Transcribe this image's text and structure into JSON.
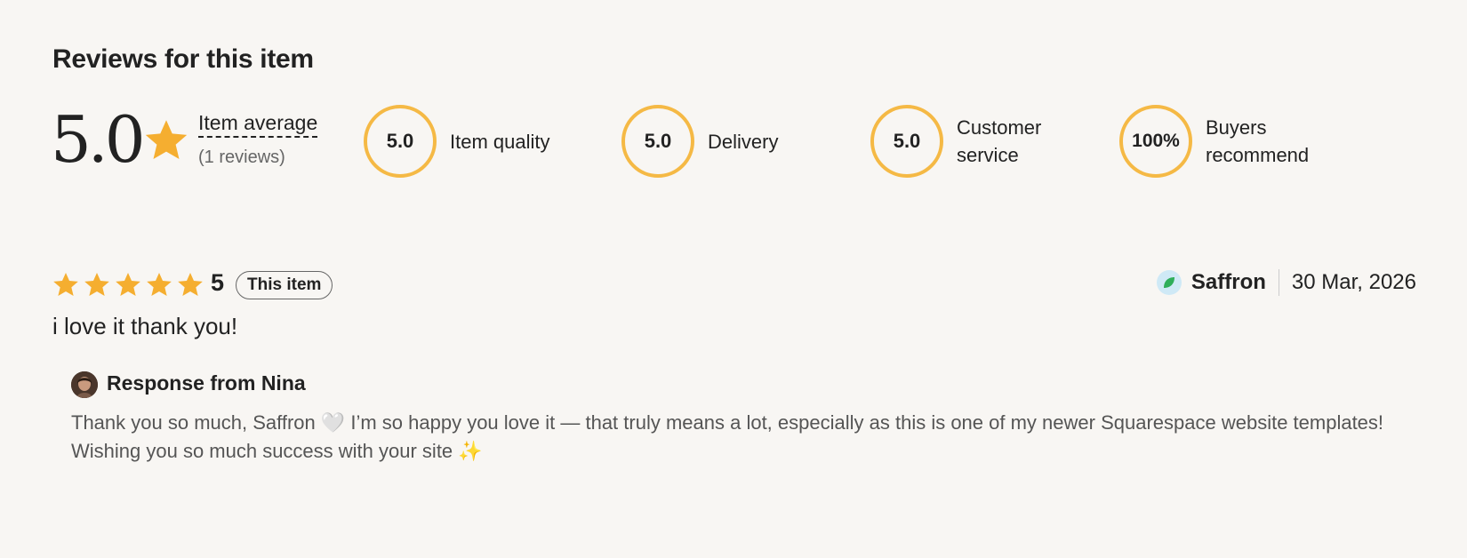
{
  "title": "Reviews for this item",
  "summary": {
    "average": "5.0",
    "average_label": "Item average",
    "review_count": "(1 reviews)",
    "metrics": [
      {
        "value": "5.0",
        "label": "Item quality"
      },
      {
        "value": "5.0",
        "label": "Delivery"
      },
      {
        "value": "5.0",
        "label": "Customer service"
      },
      {
        "value": "100%",
        "label": "Buyers recommend"
      }
    ]
  },
  "review": {
    "rating": "5",
    "stars": 5,
    "badge": "This item",
    "text": "i love it thank you!",
    "reviewer": "Saffron",
    "date": "30 Mar, 2026"
  },
  "response": {
    "title": "Response from Nina",
    "text": "Thank you so much, Saffron 🤍 I’m so happy you love it — that truly means a lot, especially as this is one of my newer Squarespace website templates! Wishing you so much success with your site ✨"
  },
  "colors": {
    "star": "#f5ae30",
    "ring": "#f5b945",
    "background": "#f8f6f3"
  },
  "icons": [
    "star-icon",
    "reviewer-avatar-icon",
    "seller-avatar-icon"
  ]
}
